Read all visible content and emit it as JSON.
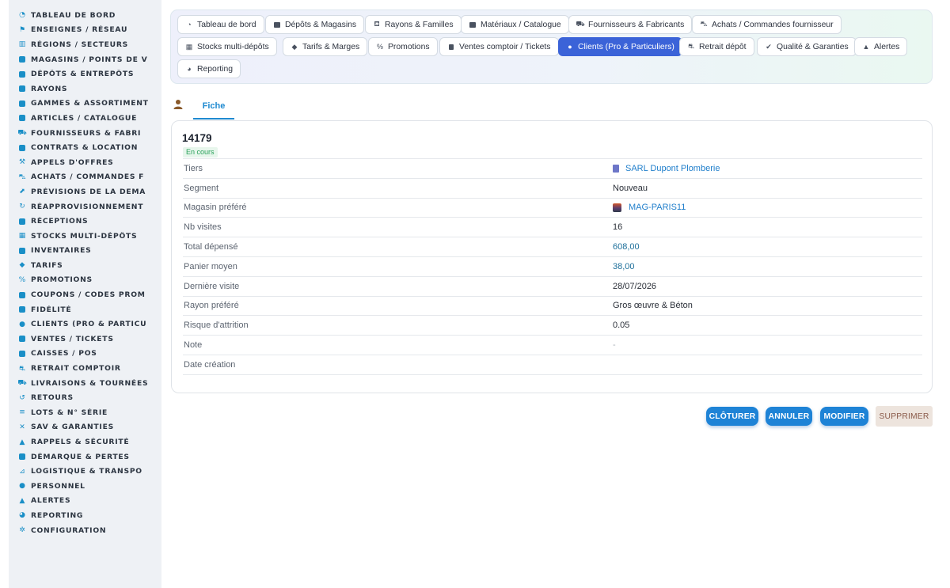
{
  "sidebar": {
    "items": [
      {
        "label": "TABLEAU DE BORD",
        "icon": "dashboard-icon"
      },
      {
        "label": "ENSEIGNES / RÉSEAU",
        "icon": "flag-icon"
      },
      {
        "label": "RÉGIONS / SECTEURS",
        "icon": "map-icon"
      },
      {
        "label": "MAGASINS / POINTS DE V",
        "icon": "store-icon"
      },
      {
        "label": "DÉPÔTS & ENTREPÔTS",
        "icon": "warehouse-icon"
      },
      {
        "label": "RAYONS",
        "icon": "shelf-icon"
      },
      {
        "label": "GAMMES & ASSORTIMENT",
        "icon": "layers-icon"
      },
      {
        "label": "ARTICLES / CATALOGUE",
        "icon": "box-icon"
      },
      {
        "label": "FOURNISSEURS & FABRI",
        "icon": "truck-icon"
      },
      {
        "label": "CONTRATS & LOCATION",
        "icon": "document-icon"
      },
      {
        "label": "APPELS D'OFFRES",
        "icon": "gavel-icon"
      },
      {
        "label": "ACHATS / COMMANDES F",
        "icon": "cart-icon"
      },
      {
        "label": "PRÉVISIONS DE LA DEMA",
        "icon": "chart-line-icon"
      },
      {
        "label": "RÉAPPROVISIONNEMENT",
        "icon": "refresh-icon"
      },
      {
        "label": "RÉCEPTIONS",
        "icon": "inbox-icon"
      },
      {
        "label": "STOCKS MULTI-DÉPÔTS",
        "icon": "boxes-icon"
      },
      {
        "label": "INVENTAIRES",
        "icon": "clipboard-check-icon"
      },
      {
        "label": "TARIFS",
        "icon": "tag-icon"
      },
      {
        "label": "PROMOTIONS",
        "icon": "percent-icon"
      },
      {
        "label": "COUPONS / CODES PROM",
        "icon": "ticket-icon"
      },
      {
        "label": "FIDÉLITÉ",
        "icon": "card-icon"
      },
      {
        "label": "CLIENTS (PRO & PARTICU",
        "icon": "user-icon"
      },
      {
        "label": "VENTES / TICKETS",
        "icon": "receipt-icon"
      },
      {
        "label": "CAISSES / POS",
        "icon": "register-icon"
      },
      {
        "label": "RETRAIT COMPTOIR",
        "icon": "car-icon"
      },
      {
        "label": "LIVRAISONS & TOURNÉES",
        "icon": "delivery-truck-icon"
      },
      {
        "label": "RETOURS",
        "icon": "undo-icon"
      },
      {
        "label": "LOTS & N° SÉRIE",
        "icon": "list-icon"
      },
      {
        "label": "SAV & GARANTIES",
        "icon": "tools-icon"
      },
      {
        "label": "RAPPELS & SÉCURITÉ",
        "icon": "warning-icon"
      },
      {
        "label": "DÉMARQUE & PERTES",
        "icon": "trash-icon"
      },
      {
        "label": "LOGISTIQUE & TRANSPO",
        "icon": "dolly-icon"
      },
      {
        "label": "PERSONNEL",
        "icon": "users-icon"
      },
      {
        "label": "ALERTES",
        "icon": "bell-icon"
      },
      {
        "label": "REPORTING",
        "icon": "pie-chart-icon"
      },
      {
        "label": "CONFIGURATION",
        "icon": "gear-icon"
      }
    ]
  },
  "modules": {
    "items": [
      {
        "label": "Tableau de bord",
        "icon": "dashboard-icon"
      },
      {
        "label": "Dépôts & Magasins",
        "icon": "warehouse-icon"
      },
      {
        "label": "Rayons & Familles",
        "icon": "basket-icon"
      },
      {
        "label": "Matériaux / Catalogue",
        "icon": "catalog-icon"
      },
      {
        "label": "Fournisseurs & Fabricants",
        "icon": "truck-icon"
      },
      {
        "label": "Achats / Commandes fournisseur",
        "icon": "cart-icon"
      },
      {
        "label": "Stocks multi-dépôts",
        "icon": "boxes-icon"
      },
      {
        "label": "Tarifs & Marges",
        "icon": "tags-icon"
      },
      {
        "label": "Promotions",
        "icon": "percent-icon"
      },
      {
        "label": "Ventes comptoir / Tickets",
        "icon": "receipt-icon"
      },
      {
        "label": "Clients (Pro & Particuliers)",
        "icon": "user-icon"
      },
      {
        "label": "Retrait dépôt",
        "icon": "car-icon"
      },
      {
        "label": "Qualité & Garanties",
        "icon": "check-double-icon"
      },
      {
        "label": "Alertes",
        "icon": "bell-icon"
      },
      {
        "label": "Reporting",
        "icon": "pie-chart-icon"
      }
    ],
    "active": "Clients (Pro & Particuliers)"
  },
  "tab": {
    "label": "Fiche"
  },
  "record": {
    "id": "14179",
    "status": "En cours",
    "fields": [
      {
        "label": "Tiers",
        "value": "SARL Dupont Plomberie"
      },
      {
        "label": "Segment",
        "value": "Nouveau"
      },
      {
        "label": "Magasin préféré",
        "value": "MAG-PARIS11"
      },
      {
        "label": "Nb visites",
        "value": "16"
      },
      {
        "label": "Total dépensé",
        "value": "608,00"
      },
      {
        "label": "Panier moyen",
        "value": "38,00"
      },
      {
        "label": "Dernière visite",
        "value": "28/07/2026"
      },
      {
        "label": "Rayon préféré",
        "value": "Gros œuvre & Béton"
      },
      {
        "label": "Risque d'attrition",
        "value": "0.05"
      },
      {
        "label": "Note",
        "value": "-"
      },
      {
        "label": "Date création",
        "value": ""
      }
    ]
  },
  "actions": {
    "close": "CLÔTURER",
    "cancel": "ANNULER",
    "edit": "MODIFIER",
    "delete": "SUPPRIMER"
  },
  "colors": {
    "accent": "#1e83d6",
    "active_module": "#3b63d8",
    "status_badge_text": "#28a15a",
    "status_badge_bg": "#e7f6ec",
    "sidebar_icon": "#1a8fc7"
  }
}
